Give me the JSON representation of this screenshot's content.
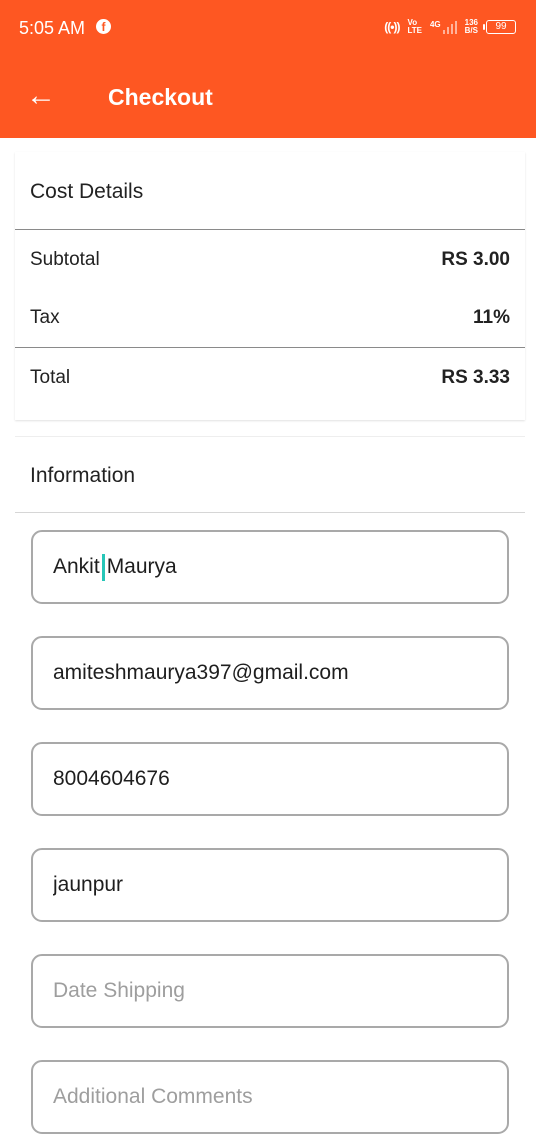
{
  "status_bar": {
    "time": "5:05 AM",
    "volte_top": "Vo",
    "volte_bottom": "LTE",
    "network": "4G",
    "speed_value": "136",
    "speed_unit": "B/S",
    "battery": "99"
  },
  "app_bar": {
    "title": "Checkout",
    "back_icon": "arrow-left-icon"
  },
  "cost_details": {
    "title": "Cost Details",
    "subtotal_label": "Subtotal",
    "subtotal_value": "RS 3.00",
    "tax_label": "Tax",
    "tax_value": "11%",
    "total_label": "Total",
    "total_value": "RS 3.33"
  },
  "information": {
    "title": "Information",
    "name_before_cursor": "Ankit",
    "name_after_cursor": "Maurya",
    "email": "amiteshmaurya397@gmail.com",
    "phone": "8004604676",
    "city": "jaunpur",
    "date_shipping_placeholder": "Date Shipping",
    "comments_placeholder": "Additional Comments"
  },
  "colors": {
    "accent": "#fe5722",
    "cursor": "#26c6b8"
  }
}
